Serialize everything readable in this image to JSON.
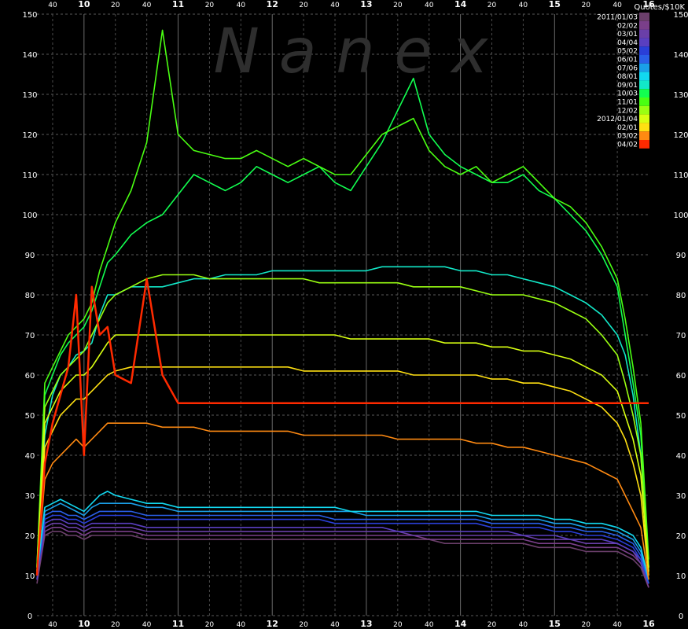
{
  "chart_data": {
    "type": "line",
    "watermark": "Nanex",
    "ylabel": "Quotes/$10K",
    "ylim": [
      0,
      150
    ],
    "y_ticks": [
      0,
      10,
      20,
      30,
      40,
      50,
      60,
      70,
      80,
      90,
      100,
      110,
      120,
      130,
      140,
      150
    ],
    "xlim": [
      "09:30",
      "16:00"
    ],
    "x_hour_ticks": [
      "10",
      "11",
      "12",
      "13",
      "14",
      "15",
      "16"
    ],
    "x_minute_ticks": [
      "40",
      "20",
      "40"
    ],
    "grid": true,
    "legend_position": "top-right",
    "x": [
      "09:30",
      "09:35",
      "09:40",
      "09:45",
      "09:50",
      "09:55",
      "10:00",
      "10:05",
      "10:10",
      "10:15",
      "10:20",
      "10:30",
      "10:40",
      "10:50",
      "11:00",
      "11:10",
      "11:20",
      "11:30",
      "11:40",
      "11:50",
      "12:00",
      "12:10",
      "12:20",
      "12:30",
      "12:40",
      "12:50",
      "13:00",
      "13:10",
      "13:20",
      "13:30",
      "13:40",
      "13:50",
      "14:00",
      "14:10",
      "14:20",
      "14:30",
      "14:40",
      "14:50",
      "15:00",
      "15:10",
      "15:20",
      "15:30",
      "15:40",
      "15:45",
      "15:50",
      "15:55",
      "16:00"
    ],
    "series": [
      {
        "name": "2011/01/03",
        "color": "#6b3f6b",
        "values": [
          8,
          20,
          21,
          21,
          20,
          20,
          19,
          20,
          20,
          20,
          20,
          20,
          19,
          19,
          19,
          19,
          19,
          19,
          19,
          19,
          19,
          19,
          19,
          19,
          19,
          19,
          19,
          19,
          19,
          19,
          19,
          18,
          18,
          18,
          18,
          18,
          18,
          17,
          17,
          17,
          16,
          16,
          16,
          15,
          14,
          12,
          7
        ]
      },
      {
        "name": "02/02",
        "color": "#7a3f8a",
        "values": [
          9,
          21,
          22,
          22,
          21,
          21,
          20,
          21,
          21,
          21,
          21,
          21,
          20,
          20,
          20,
          20,
          20,
          20,
          20,
          20,
          20,
          20,
          20,
          20,
          20,
          20,
          20,
          20,
          20,
          20,
          19,
          19,
          19,
          19,
          19,
          19,
          19,
          18,
          18,
          18,
          17,
          17,
          17,
          16,
          15,
          13,
          7
        ]
      },
      {
        "name": "03/01",
        "color": "#6a3fa8",
        "values": [
          9,
          22,
          23,
          23,
          22,
          22,
          21,
          22,
          22,
          22,
          22,
          22,
          21,
          21,
          21,
          21,
          21,
          21,
          21,
          21,
          21,
          21,
          21,
          21,
          21,
          21,
          21,
          21,
          21,
          20,
          20,
          20,
          20,
          20,
          20,
          20,
          20,
          19,
          19,
          19,
          18,
          18,
          18,
          17,
          16,
          13,
          8
        ]
      },
      {
        "name": "04/04",
        "color": "#5a3fc0",
        "values": [
          9,
          23,
          24,
          24,
          23,
          23,
          22,
          23,
          23,
          23,
          23,
          23,
          22,
          22,
          22,
          22,
          22,
          22,
          22,
          22,
          22,
          22,
          22,
          22,
          22,
          22,
          22,
          22,
          21,
          21,
          21,
          21,
          21,
          21,
          21,
          21,
          20,
          20,
          20,
          19,
          19,
          19,
          18,
          17,
          16,
          14,
          8
        ]
      },
      {
        "name": "05/02",
        "color": "#2a3fd8",
        "values": [
          10,
          24,
          25,
          25,
          24,
          24,
          23,
          24,
          25,
          25,
          25,
          25,
          24,
          24,
          24,
          24,
          24,
          24,
          24,
          24,
          24,
          24,
          24,
          24,
          23,
          23,
          23,
          23,
          23,
          23,
          23,
          23,
          23,
          23,
          22,
          22,
          22,
          22,
          21,
          21,
          20,
          20,
          19,
          18,
          17,
          14,
          8
        ]
      },
      {
        "name": "06/01",
        "color": "#2a5fe8",
        "values": [
          10,
          25,
          26,
          26,
          25,
          25,
          24,
          25,
          26,
          26,
          26,
          26,
          25,
          25,
          25,
          25,
          25,
          25,
          25,
          25,
          25,
          25,
          25,
          25,
          24,
          24,
          24,
          24,
          24,
          24,
          24,
          24,
          24,
          24,
          23,
          23,
          23,
          23,
          22,
          22,
          21,
          21,
          20,
          19,
          18,
          15,
          8
        ]
      },
      {
        "name": "07/06",
        "color": "#1a9fe8",
        "values": [
          10,
          26,
          27,
          28,
          27,
          26,
          25,
          27,
          28,
          28,
          28,
          28,
          27,
          27,
          26,
          26,
          26,
          26,
          26,
          26,
          26,
          26,
          26,
          26,
          26,
          26,
          25,
          25,
          25,
          25,
          25,
          25,
          25,
          25,
          24,
          24,
          24,
          24,
          23,
          23,
          22,
          22,
          21,
          20,
          19,
          16,
          9
        ]
      },
      {
        "name": "08/01",
        "color": "#12d8f0",
        "values": [
          11,
          27,
          28,
          29,
          28,
          27,
          26,
          28,
          30,
          31,
          30,
          29,
          28,
          28,
          27,
          27,
          27,
          27,
          27,
          27,
          27,
          27,
          27,
          27,
          27,
          26,
          26,
          26,
          26,
          26,
          26,
          26,
          26,
          26,
          25,
          25,
          25,
          25,
          24,
          24,
          23,
          23,
          22,
          21,
          20,
          17,
          9
        ]
      },
      {
        "name": "09/01",
        "color": "#12e8c8",
        "values": [
          12,
          45,
          55,
          60,
          62,
          65,
          66,
          68,
          75,
          80,
          80,
          82,
          82,
          82,
          83,
          84,
          84,
          85,
          85,
          85,
          86,
          86,
          86,
          86,
          86,
          86,
          86,
          87,
          87,
          87,
          87,
          87,
          86,
          86,
          85,
          85,
          84,
          83,
          82,
          80,
          78,
          75,
          70,
          65,
          55,
          40,
          12
        ]
      },
      {
        "name": "10/03",
        "color": "#12ff50",
        "values": [
          12,
          55,
          60,
          65,
          68,
          70,
          72,
          76,
          82,
          88,
          90,
          95,
          98,
          100,
          105,
          110,
          108,
          106,
          108,
          112,
          110,
          108,
          110,
          112,
          108,
          106,
          112,
          118,
          126,
          134,
          120,
          115,
          112,
          110,
          108,
          108,
          110,
          106,
          104,
          100,
          96,
          90,
          82,
          70,
          58,
          45,
          12
        ]
      },
      {
        "name": "11/01",
        "color": "#4aff12",
        "values": [
          12,
          58,
          62,
          66,
          70,
          72,
          74,
          78,
          86,
          92,
          98,
          106,
          118,
          146,
          120,
          116,
          115,
          114,
          114,
          116,
          114,
          112,
          114,
          112,
          110,
          110,
          115,
          120,
          122,
          124,
          116,
          112,
          110,
          112,
          108,
          110,
          112,
          108,
          104,
          102,
          98,
          92,
          84,
          74,
          62,
          48,
          14
        ]
      },
      {
        "name": "12/02",
        "color": "#9aff12",
        "values": [
          12,
          52,
          56,
          60,
          62,
          64,
          66,
          70,
          74,
          78,
          80,
          82,
          84,
          85,
          85,
          85,
          84,
          84,
          84,
          84,
          84,
          84,
          84,
          83,
          83,
          83,
          83,
          83,
          83,
          82,
          82,
          82,
          82,
          81,
          80,
          80,
          80,
          79,
          78,
          76,
          74,
          70,
          65,
          58,
          50,
          40,
          12
        ]
      },
      {
        "name": "2012/01/04",
        "color": "#d8ff12",
        "values": [
          11,
          48,
          52,
          56,
          58,
          60,
          60,
          62,
          65,
          68,
          70,
          70,
          70,
          70,
          70,
          70,
          70,
          70,
          70,
          70,
          70,
          70,
          70,
          70,
          70,
          69,
          69,
          69,
          69,
          69,
          69,
          68,
          68,
          68,
          67,
          67,
          66,
          66,
          65,
          64,
          62,
          60,
          56,
          50,
          44,
          35,
          11
        ]
      },
      {
        "name": "02/01",
        "color": "#ffe012",
        "values": [
          11,
          42,
          46,
          50,
          52,
          54,
          54,
          56,
          58,
          60,
          61,
          62,
          62,
          62,
          62,
          62,
          62,
          62,
          62,
          62,
          62,
          62,
          61,
          61,
          61,
          61,
          61,
          61,
          61,
          60,
          60,
          60,
          60,
          60,
          59,
          59,
          58,
          58,
          57,
          56,
          54,
          52,
          48,
          44,
          38,
          30,
          10
        ]
      },
      {
        "name": "03/02",
        "color": "#ff8a12",
        "values": [
          10,
          34,
          38,
          40,
          42,
          44,
          42,
          44,
          46,
          48,
          48,
          48,
          48,
          47,
          47,
          47,
          46,
          46,
          46,
          46,
          46,
          46,
          45,
          45,
          45,
          45,
          45,
          45,
          44,
          44,
          44,
          44,
          44,
          43,
          43,
          42,
          42,
          41,
          40,
          39,
          38,
          36,
          34,
          30,
          26,
          22,
          9
        ]
      },
      {
        "name": "04/02",
        "color": "#ff2a00",
        "values": [
          10,
          38,
          48,
          55,
          62,
          80,
          40,
          82,
          70,
          72,
          60,
          58,
          84,
          60,
          53,
          53,
          53,
          53,
          53,
          53,
          53,
          53,
          53,
          53,
          53,
          53,
          53,
          53,
          53,
          53,
          53,
          53,
          53,
          53,
          53,
          53,
          53,
          53,
          53,
          53,
          53,
          53,
          53,
          53,
          53,
          53,
          53
        ]
      }
    ]
  }
}
